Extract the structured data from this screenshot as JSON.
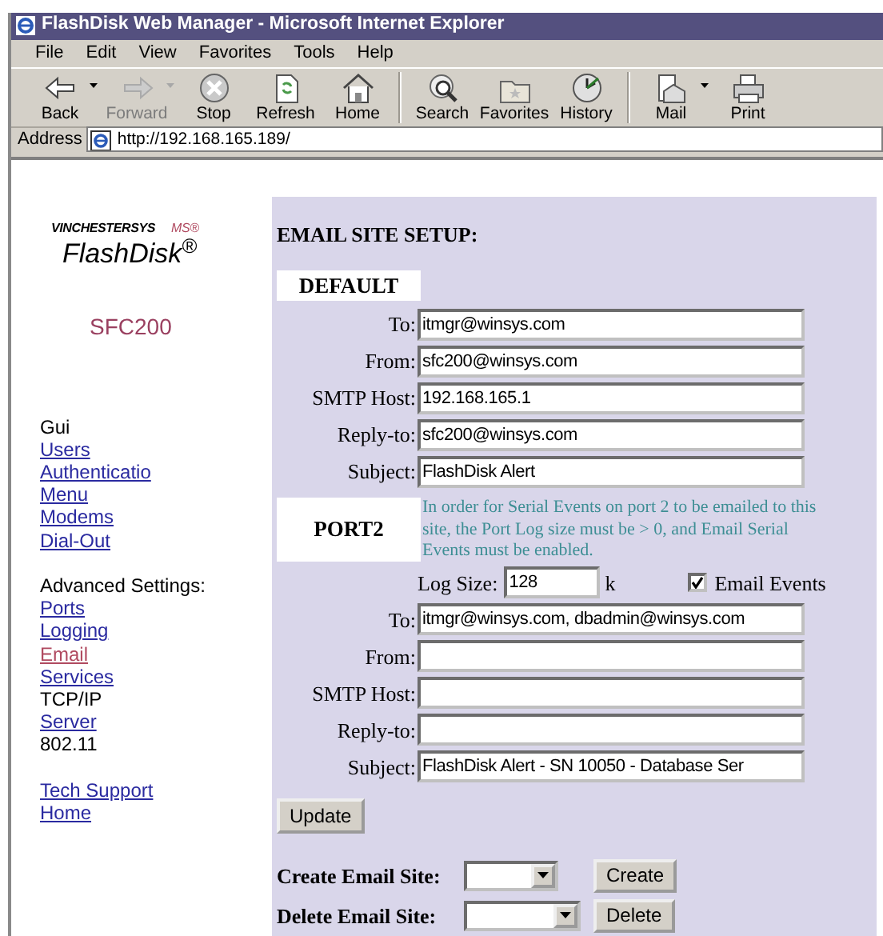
{
  "window": {
    "title": "FlashDisk Web Manager - Microsoft Internet Explorer"
  },
  "menu": [
    {
      "label": "File"
    },
    {
      "label": "Edit"
    },
    {
      "label": "View"
    },
    {
      "label": "Favorites"
    },
    {
      "label": "Tools"
    },
    {
      "label": "Help"
    }
  ],
  "toolbar": {
    "groups": [
      [
        {
          "label": "Back",
          "kind": "back",
          "disabled": false,
          "dropdown": true
        },
        {
          "label": "Forward",
          "kind": "forward",
          "disabled": true,
          "dropdown": true
        },
        {
          "label": "Stop",
          "kind": "stop",
          "disabled": false,
          "dropdown": false
        },
        {
          "label": "Refresh",
          "kind": "refresh",
          "disabled": false,
          "dropdown": false
        },
        {
          "label": "Home",
          "kind": "home",
          "disabled": false,
          "dropdown": false
        }
      ],
      [
        {
          "label": "Search",
          "kind": "search",
          "disabled": false,
          "dropdown": false
        },
        {
          "label": "Favorites",
          "kind": "favorites",
          "disabled": false,
          "dropdown": false
        },
        {
          "label": "History",
          "kind": "history",
          "disabled": false,
          "dropdown": false
        }
      ],
      [
        {
          "label": "Mail",
          "kind": "mail",
          "disabled": false,
          "dropdown": true
        },
        {
          "label": "Print",
          "kind": "print",
          "disabled": false,
          "dropdown": false
        }
      ]
    ]
  },
  "address": {
    "label": "Address",
    "value": "http://192.168.165.189/"
  },
  "sidebar": {
    "logo": {
      "brand": "VINCHESTERSYS",
      "brand_tail": "MS®",
      "product": "FlashDisk$^{®}$"
    },
    "model": "SFC200",
    "sections": [
      [
        {
          "label": "Gui",
          "kind": "heading",
          "selected": false
        },
        {
          "label": "Users",
          "kind": "link",
          "selected": false
        },
        {
          "label": "Authenticatio",
          "kind": "link",
          "selected": false
        },
        {
          "label": "Menu",
          "kind": "link",
          "selected": false
        },
        {
          "label": "Modems",
          "kind": "link",
          "selected": false
        },
        {
          "label": "Dial-Out",
          "kind": "link",
          "selected": false
        }
      ],
      [
        {
          "label": "Advanced Settings:",
          "kind": "heading",
          "selected": false
        },
        {
          "label": "Ports",
          "kind": "link",
          "selected": false
        },
        {
          "label": "Logging",
          "kind": "link",
          "selected": false
        },
        {
          "label": "Email",
          "kind": "link",
          "selected": true
        },
        {
          "label": "Services",
          "kind": "link",
          "selected": false
        },
        {
          "label": "TCP/IP",
          "kind": "heading",
          "selected": false
        },
        {
          "label": "Server",
          "kind": "link",
          "selected": false
        },
        {
          "label": "802.11",
          "kind": "heading",
          "selected": false
        }
      ],
      [
        {
          "label": "Tech Support",
          "kind": "link",
          "selected": false
        },
        {
          "label": "Home",
          "kind": "link",
          "selected": false
        }
      ]
    ]
  },
  "main": {
    "title": "EMAIL SITE SETUP:",
    "default": {
      "label": "DEFAULT",
      "fields": [
        {
          "label": "To:",
          "value": "itmgr@winsys.com"
        },
        {
          "label": "From:",
          "value": "sfc200@winsys.com"
        },
        {
          "label": "SMTP Host:",
          "value": "192.168.165.1"
        },
        {
          "label": "Reply-to:",
          "value": "sfc200@winsys.com"
        },
        {
          "label": "Subject:",
          "value": "FlashDisk Alert"
        }
      ]
    },
    "port": {
      "label": "PORT2",
      "note": "In order for Serial Events on port 2 to be emailed to this site, the Port Log size must be > 0, and Email Serial Events must be enabled.",
      "log_size": {
        "label": "Log Size:",
        "value": "128",
        "unit": "k"
      },
      "email_events": {
        "label": "Email Events",
        "checked": true
      },
      "fields": [
        {
          "label": "To:",
          "value": "itmgr@winsys.com, dbadmin@winsys.com"
        },
        {
          "label": "From:"
        },
        {
          "label": "SMTP Host:"
        },
        {
          "label": "Reply-to:"
        },
        {
          "label": "Subject:",
          "value": "FlashDisk Alert - SN 10050 - Database Ser"
        }
      ]
    },
    "update_button": "Update",
    "site_actions": [
      {
        "label": "Create Email Site:",
        "button": "Create"
      },
      {
        "label": "Delete Email Site:",
        "button": "Delete"
      }
    ]
  }
}
